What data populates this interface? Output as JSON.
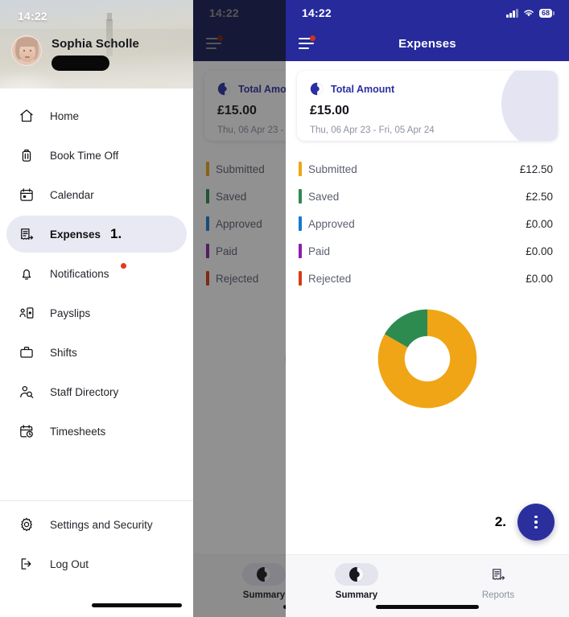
{
  "colors": {
    "navy": "#262a9b",
    "accent_blue": "#2b2fa3",
    "submitted": "#efa515",
    "saved": "#2e8b50",
    "approved": "#1779cf",
    "paid": "#8d1fa8",
    "rejected": "#d93b16",
    "notification_dot": "#cf3418",
    "active_pill": "#e9e9f3"
  },
  "drawer": {
    "status_time": "14:22",
    "profile": {
      "name": "Sophia Scholle",
      "redacted_label": ""
    },
    "items": [
      {
        "label": "Home",
        "icon": "home-icon",
        "active": false,
        "badge": null,
        "step": null
      },
      {
        "label": "Book Time Off",
        "icon": "suitcase-icon",
        "active": false,
        "badge": null,
        "step": null
      },
      {
        "label": "Calendar",
        "icon": "calendar-icon",
        "active": false,
        "badge": null,
        "step": null
      },
      {
        "label": "Expenses",
        "icon": "receipt-icon",
        "active": true,
        "badge": null,
        "step": "1."
      },
      {
        "label": "Notifications",
        "icon": "bell-icon",
        "active": false,
        "badge": "dot",
        "step": null
      },
      {
        "label": "Payslips",
        "icon": "payslip-icon",
        "active": false,
        "badge": null,
        "step": null
      },
      {
        "label": "Shifts",
        "icon": "briefcase-icon",
        "active": false,
        "badge": null,
        "step": null
      },
      {
        "label": "Staff Directory",
        "icon": "person-search-icon",
        "active": false,
        "badge": null,
        "step": null
      },
      {
        "label": "Timesheets",
        "icon": "calendar-clock-icon",
        "active": false,
        "badge": null,
        "step": null
      }
    ],
    "bottom_items": [
      {
        "label": "Settings and Security",
        "icon": "gear-icon"
      },
      {
        "label": "Log Out",
        "icon": "logout-icon"
      }
    ]
  },
  "phone": {
    "status_bar": {
      "time": "14:22",
      "signal_icon": "signal-bars-icon",
      "wifi_icon": "wifi-icon",
      "battery_level": "68",
      "battery_icon": "battery-icon"
    },
    "navbar": {
      "menu_icon": "hamburger-menu-icon",
      "title": "Expenses",
      "has_notification_dot": true
    },
    "total_card": {
      "icon": "pie-chart-icon",
      "title": "Total Amount",
      "amount": "£15.00",
      "date_range": "Thu, 06 Apr 23 -  Fri, 05 Apr 24"
    },
    "statuses": [
      {
        "label": "Submitted",
        "value": "£12.50",
        "color": "#efa515"
      },
      {
        "label": "Saved",
        "value": "£2.50",
        "color": "#2e8b50"
      },
      {
        "label": "Approved",
        "value": "£0.00",
        "color": "#1779cf"
      },
      {
        "label": "Paid",
        "value": "£0.00",
        "color": "#8d1fa8"
      },
      {
        "label": "Rejected",
        "value": "£0.00",
        "color": "#d93b16"
      }
    ],
    "fab": {
      "step": "2.",
      "icon": "more-vertical-icon"
    },
    "bottom_nav": [
      {
        "label": "Summary",
        "icon": "pie-chart-icon",
        "active": true
      },
      {
        "label": "Reports",
        "icon": "receipt-icon",
        "active": false
      }
    ]
  },
  "chart_data": {
    "type": "pie",
    "title": "Total Amount",
    "subtitle": "£15.00",
    "labels": [
      "Submitted",
      "Saved",
      "Approved",
      "Paid",
      "Rejected"
    ],
    "values": [
      12.5,
      2.5,
      0.0,
      0.0,
      0.0
    ],
    "percentages": [
      83.3,
      16.7,
      0,
      0,
      0
    ],
    "colors": [
      "#efa515",
      "#2e8b50",
      "#1779cf",
      "#8d1fa8",
      "#d93b16"
    ],
    "currency": "GBP",
    "total": 15.0,
    "donut": true,
    "inner_radius_ratio": 0.46,
    "start_angle_deg": 0,
    "direction": "clockwise",
    "legend_position": "top",
    "grid": false
  }
}
